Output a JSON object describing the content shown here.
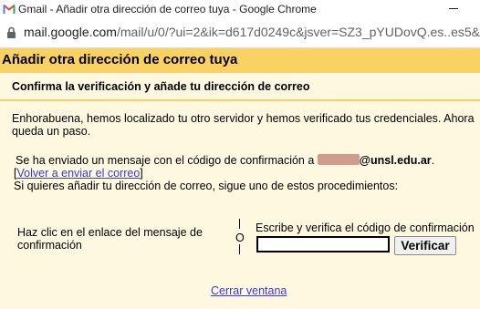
{
  "browser": {
    "window_title": "Gmail - Añadir otra dirección de correo tuya - Google Chrome",
    "url_host": "mail.google.com",
    "url_path": "/mail/u/0/?ui=2&ik=d617d0249c&jsver=SZ3_pYUDovQ.es..es5&"
  },
  "page": {
    "title": "Añadir otra dirección de correo tuya",
    "subtitle": "Confirma la verificación y añade tu dirección de correo",
    "intro_line1": "Enhorabuena, hemos localizado tu otro servidor y hemos verificado tus credenciales. Ahora",
    "intro_line2": "queda un paso.",
    "sent_prefix": "Se ha enviado un mensaje con el código de confirmación a",
    "sent_email_domain": "@unsl.edu.ar",
    "sent_suffix": ".",
    "resend_link": "Volver a enviar el correo",
    "instructions": "Si quieres añadir tu dirección de correo, sigue uno de estos procedimientos:",
    "option_left_line1": "Haz clic en el enlace del mensaje de",
    "option_left_line2": "confirmación",
    "or_label": "O",
    "option_right_label": "Escribe y verifica el código de confirmación",
    "code_value": "",
    "verify_button": "Verificar",
    "close_link": "Cerrar ventana"
  },
  "colors": {
    "header_bg": "#fad163",
    "page_bg": "#fff8e1",
    "link": "#3b3bd6",
    "gmail_red": "#ea4335"
  },
  "icons": {
    "tab_icon": "gmail-icon",
    "address_icon": "lock-icon"
  }
}
